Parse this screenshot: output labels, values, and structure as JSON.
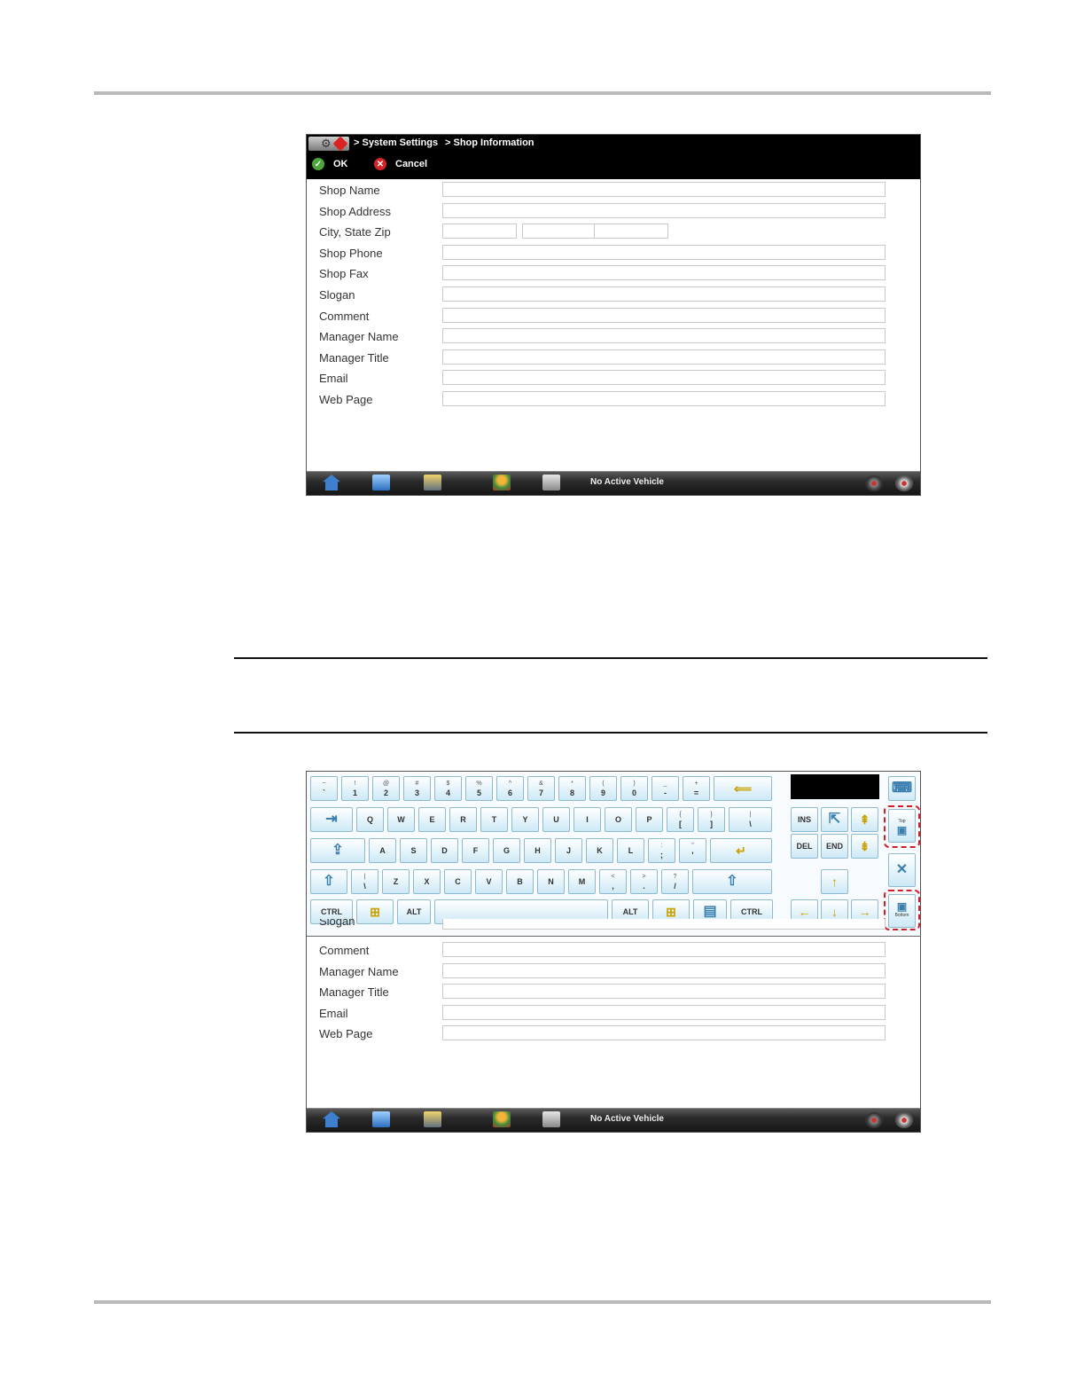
{
  "topbar": {
    "crumb1": "> System Settings",
    "crumb2": "> Shop Information",
    "ok_label": "OK",
    "cancel_label": "Cancel"
  },
  "form": {
    "fields": [
      "Shop Name",
      "Shop Address",
      "City, State Zip",
      "Shop Phone",
      "Shop Fax",
      "Slogan",
      "Comment",
      "Manager Name",
      "Manager Title",
      "Email",
      "Web Page"
    ]
  },
  "taskbar": {
    "status": "No Active Vehicle"
  },
  "keyboard": {
    "row1": [
      {
        "top": "~",
        "main": "`"
      },
      {
        "top": "!",
        "main": "1"
      },
      {
        "top": "@",
        "main": "2"
      },
      {
        "top": "#",
        "main": "3"
      },
      {
        "top": "$",
        "main": "4"
      },
      {
        "top": "%",
        "main": "5"
      },
      {
        "top": "^",
        "main": "6"
      },
      {
        "top": "&",
        "main": "7"
      },
      {
        "top": "*",
        "main": "8"
      },
      {
        "top": "(",
        "main": "9"
      },
      {
        "top": ")",
        "main": "0"
      },
      {
        "top": "_",
        "main": "-"
      },
      {
        "top": "+",
        "main": "="
      }
    ],
    "row2": [
      "Q",
      "W",
      "E",
      "R",
      "T",
      "Y",
      "U",
      "I",
      "O",
      "P"
    ],
    "row2_sym": [
      {
        "top": "{",
        "main": "["
      },
      {
        "top": "}",
        "main": "]"
      },
      {
        "top": "|",
        "main": "\\"
      }
    ],
    "row3": [
      "A",
      "S",
      "D",
      "F",
      "G",
      "H",
      "J",
      "K",
      "L"
    ],
    "row3_sym": [
      {
        "top": ":",
        "main": ";"
      },
      {
        "top": "\"",
        "main": "'"
      }
    ],
    "row4_first": {
      "top": "|",
      "main": "\\"
    },
    "row4": [
      "Z",
      "X",
      "C",
      "V",
      "B",
      "N",
      "M"
    ],
    "row4_sym": [
      {
        "top": "<",
        "main": ","
      },
      {
        "top": ">",
        "main": "."
      },
      {
        "top": "?",
        "main": "/"
      }
    ],
    "ctrl": "CTRL",
    "alt": "ALT",
    "ins": "INS",
    "del": "DEL",
    "end": "END",
    "top_label": "Top",
    "bottom_label": "Bottom"
  },
  "form2": {
    "partial": "Slogan",
    "fields": [
      "Comment",
      "Manager Name",
      "Manager Title",
      "Email",
      "Web Page"
    ]
  }
}
